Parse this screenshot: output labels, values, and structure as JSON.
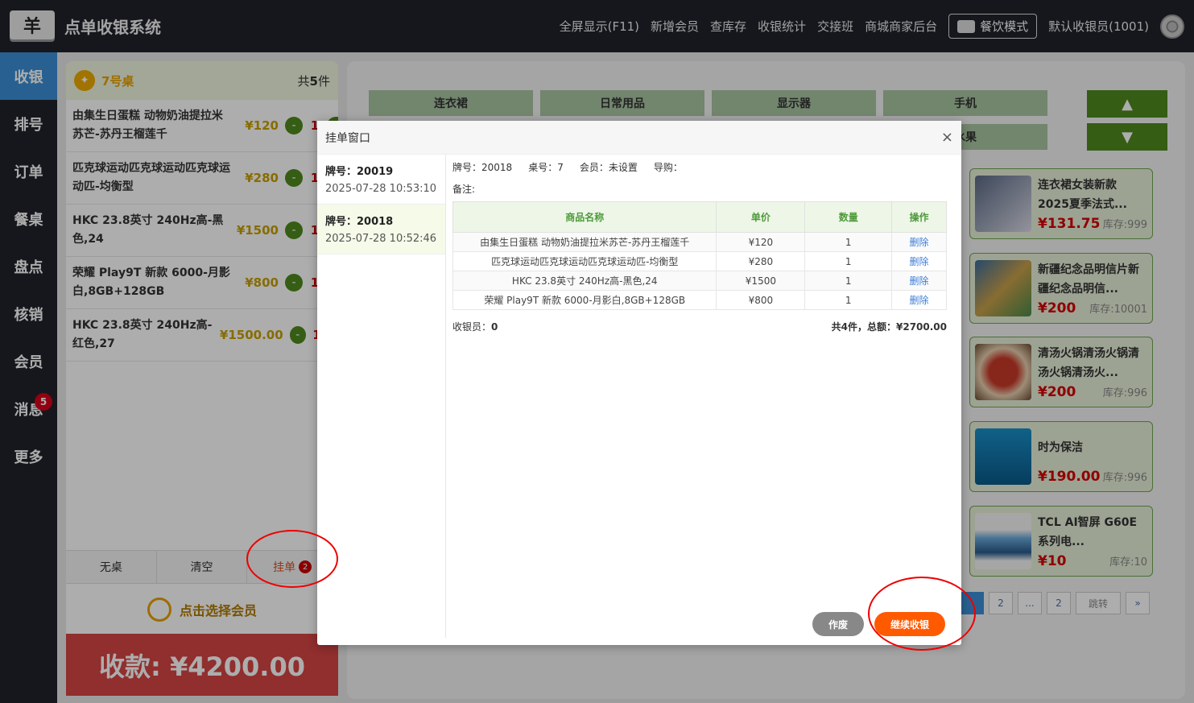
{
  "app": {
    "logo": "羊",
    "title": "点单收银系统"
  },
  "topnav": {
    "links": [
      "全屏显示(F11)",
      "新增会员",
      "查库存",
      "收银统计",
      "交接班",
      "商城商家后台"
    ],
    "mode": "餐饮模式",
    "cashier": "默认收银员(1001)"
  },
  "sidebar": {
    "items": [
      {
        "label": "收银"
      },
      {
        "label": "排号"
      },
      {
        "label": "订单"
      },
      {
        "label": "餐桌"
      },
      {
        "label": "盘点"
      },
      {
        "label": "核销"
      },
      {
        "label": "会员"
      },
      {
        "label": "消息",
        "badge": "5"
      },
      {
        "label": "更多"
      }
    ]
  },
  "order": {
    "table": "7号桌",
    "count_pre": "共",
    "count": "5",
    "count_post": "件",
    "items": [
      {
        "name": "由集生日蛋糕 动物奶油提拉米苏芒-苏丹王榴莲千",
        "price": "¥120",
        "qty": "1"
      },
      {
        "name": "匹克球运动匹克球运动匹克球运动匹-均衡型",
        "price": "¥280",
        "qty": "1"
      },
      {
        "name": "HKC 23.8英寸 240Hz高-黑色,24",
        "price": "¥1500",
        "qty": "1"
      },
      {
        "name": "荣耀 Play9T 新款 6000-月影白,8GB+128GB",
        "price": "¥800",
        "qty": "1"
      },
      {
        "name": "HKC 23.8英寸 240Hz高-红色,27",
        "price": "¥1500.00",
        "qty": "1"
      }
    ],
    "actions": {
      "no_table": "无桌",
      "clear": "清空",
      "hold": "挂单",
      "hold_count": "2"
    },
    "member": "点击选择会员",
    "pay": "收款: ¥4200.00",
    "minus": "-"
  },
  "categories": [
    "连衣裙",
    "日常用品",
    "显示器",
    "手机",
    "水果"
  ],
  "arrows": {
    "up": "▲",
    "down": "▼"
  },
  "products": [
    {
      "name": "连衣裙女装新款2025夏季法式...",
      "price": "¥131.75",
      "stock": "库存:999"
    },
    {
      "name": "新疆纪念品明信片新疆纪念品明信...",
      "price": "¥200",
      "stock": "库存:10001"
    },
    {
      "name": "清汤火锅清汤火锅清汤火锅清汤火...",
      "price": "¥200",
      "stock": "库存:996"
    },
    {
      "name": "时为保洁",
      "price": "¥190.00",
      "stock": "库存:996"
    },
    {
      "name": "TCL AI智屏 G60E系列电...",
      "price": "¥10",
      "stock": "库存:10"
    }
  ],
  "pager": [
    "2",
    "...",
    "2",
    "跳转",
    "»"
  ],
  "modal": {
    "title": "挂单窗口",
    "close": "×",
    "holds": [
      {
        "no": "牌号：20019",
        "time": "2025-07-28 10:53:10"
      },
      {
        "no": "牌号：20018",
        "time": "2025-07-28 10:52:46"
      }
    ],
    "info": {
      "no": "牌号：20018",
      "table": "桌号：7",
      "member": "会员：未设置",
      "guide": "导购："
    },
    "note": "备注:",
    "columns": [
      "商品名称",
      "单价",
      "数量",
      "操作"
    ],
    "rows": [
      {
        "name": "由集生日蛋糕 动物奶油提拉米苏芒-苏丹王榴莲千",
        "price": "¥120",
        "qty": "1",
        "op": "删除"
      },
      {
        "name": "匹克球运动匹克球运动匹克球运动匹-均衡型",
        "price": "¥280",
        "qty": "1",
        "op": "删除"
      },
      {
        "name": "HKC 23.8英寸 240Hz高-黑色,24",
        "price": "¥1500",
        "qty": "1",
        "op": "删除"
      },
      {
        "name": "荣耀 Play9T 新款 6000-月影白,8GB+128GB",
        "price": "¥800",
        "qty": "1",
        "op": "删除"
      }
    ],
    "cashier_label": "收银员：",
    "cashier_value": "0",
    "summary": "共4件，总额：¥2700.00",
    "void": "作废",
    "continue": "继续收银"
  }
}
